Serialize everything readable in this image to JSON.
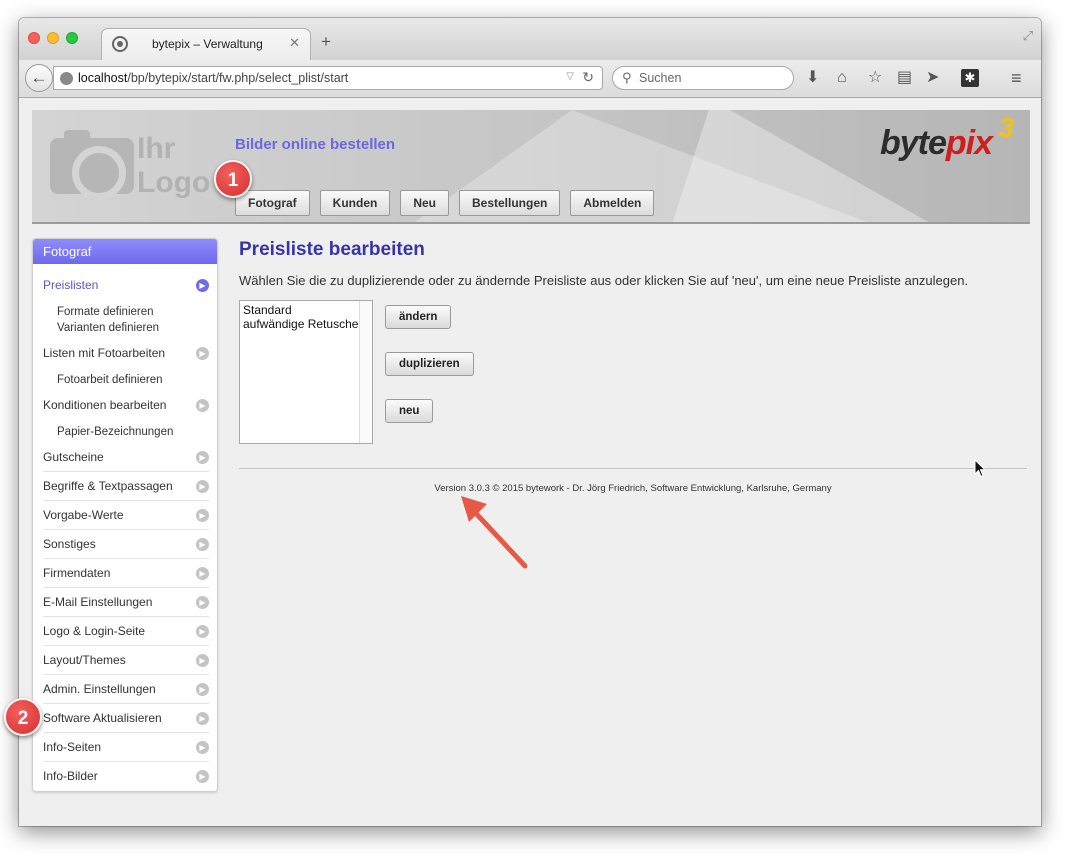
{
  "browser": {
    "tab_title": "bytepix – Verwaltung",
    "tab_close": "✕",
    "new_tab": "+",
    "url_host": "localhost",
    "url_path": "/bp/bytepix/start/fw.php/select_plist/start",
    "search_placeholder": "Suchen",
    "back_glyph": "←",
    "reload_glyph": "↻",
    "icons": [
      "download-icon",
      "home-icon",
      "bookmark-star-icon",
      "reading-list-icon",
      "send-icon",
      "extension-icon",
      "menu-icon"
    ]
  },
  "banner": {
    "logo_placeholder_line1": "Ihr",
    "logo_placeholder_line2": "Logo",
    "tagline": "Bilder online bestellen",
    "brand_byte": "byte",
    "brand_pix": "pix",
    "brand_version": "3",
    "nav": [
      "Fotograf",
      "Kunden",
      "Neu",
      "Bestellungen",
      "Abmelden"
    ]
  },
  "sidebar": {
    "header": "Fotograf",
    "items": [
      {
        "label": "Preislisten",
        "active": true
      },
      {
        "label": "Listen mit Fotoarbeiten"
      },
      {
        "label": "Konditionen bearbeiten"
      },
      {
        "label": "Gutscheine"
      },
      {
        "label": "Begriffe & Textpassagen"
      },
      {
        "label": "Vorgabe-Werte"
      },
      {
        "label": "Sonstiges"
      },
      {
        "label": "Firmendaten"
      },
      {
        "label": "E-Mail Einstellungen"
      },
      {
        "label": "Logo & Login-Seite"
      },
      {
        "label": "Layout/Themes"
      },
      {
        "label": "Admin. Einstellungen"
      },
      {
        "label": "Software Aktualisieren"
      },
      {
        "label": "Info-Seiten"
      },
      {
        "label": "Info-Bilder"
      }
    ],
    "subitems": {
      "preislisten": [
        "Formate definieren",
        "Varianten definieren"
      ],
      "fotoarbeiten": [
        "Fotoarbeit definieren"
      ],
      "konditionen": [
        "Papier-Bezeichnungen"
      ]
    }
  },
  "main": {
    "title": "Preisliste bearbeiten",
    "description": "Wählen Sie die zu duplizierende oder zu ändernde Preisliste aus oder klicken Sie auf 'neu', um eine neue Preisliste anzulegen.",
    "price_lists": [
      "Standard",
      "aufwändige Retusche"
    ],
    "buttons": {
      "edit": "ändern",
      "duplicate": "duplizieren",
      "new": "neu"
    },
    "footer": "Version 3.0.3 © 2015 bytework - Dr. Jörg Friedrich, Software Entwicklung, Karlsruhe, Germany"
  },
  "callouts": {
    "one": "1",
    "two": "2"
  },
  "colors": {
    "accent": "#6d69ea",
    "title": "#3634a8",
    "callout": "#d6302d",
    "brand_red": "#cc1f1f",
    "brand_gold": "#f0c21a"
  }
}
